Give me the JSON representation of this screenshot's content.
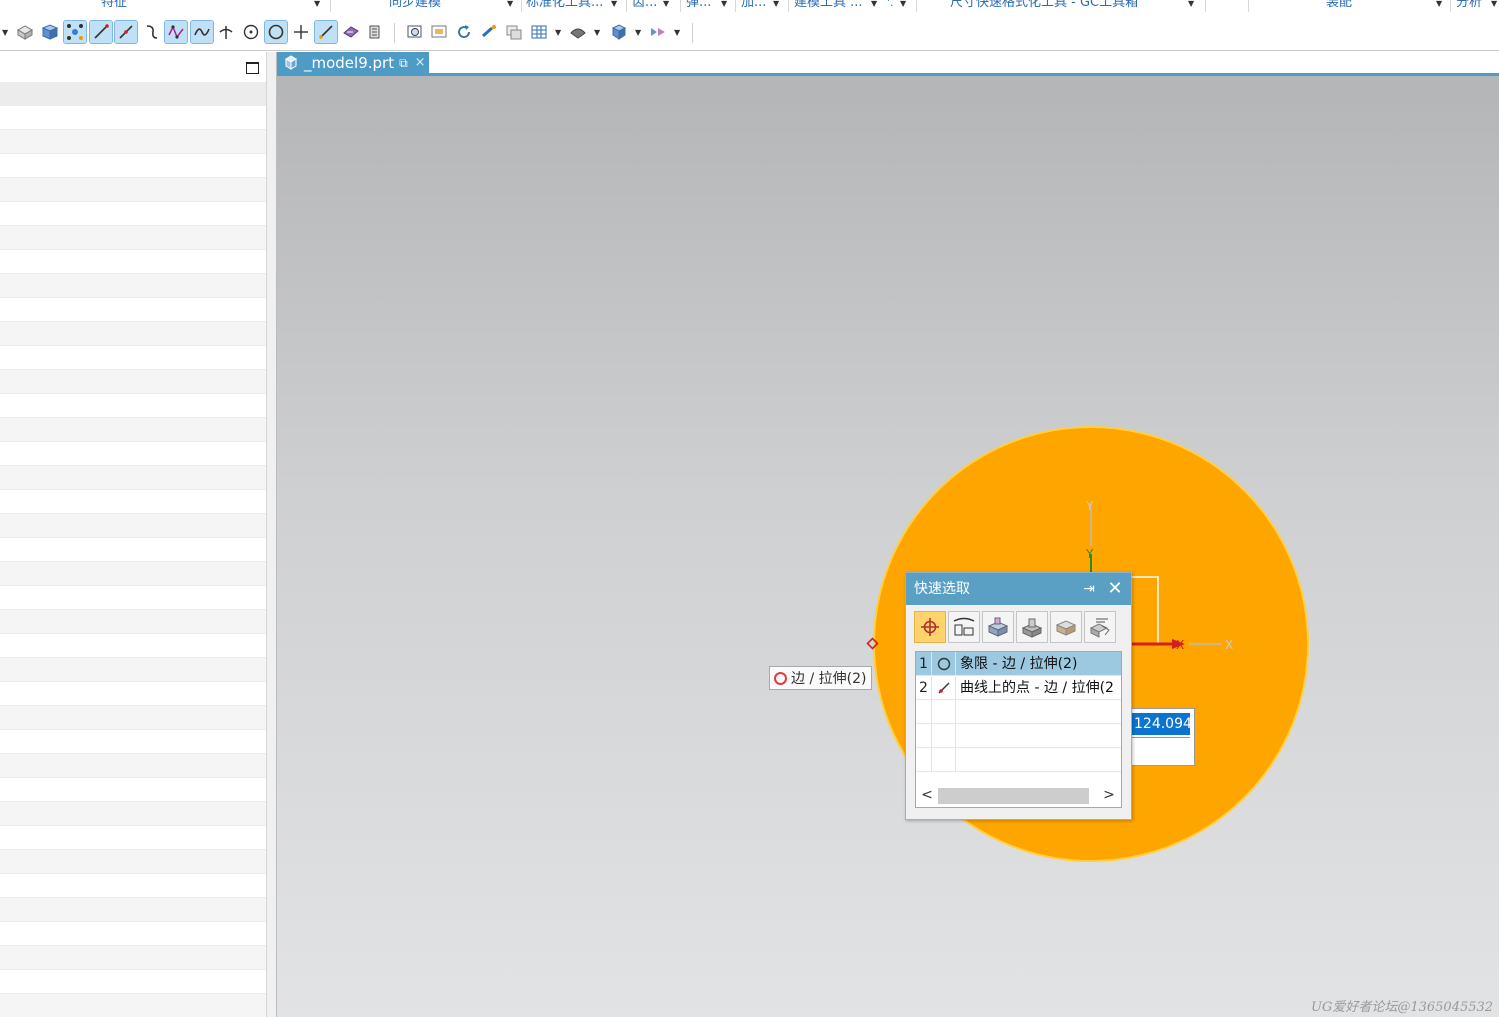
{
  "ribbon_groups": [
    {
      "label": "特征"
    },
    {
      "label": "同步建模"
    },
    {
      "label": "标准化工具..."
    },
    {
      "label": "齿..."
    },
    {
      "label": "弹..."
    },
    {
      "label": "加..."
    },
    {
      "label": "建模工具 ..."
    },
    {
      "label": "尺寸快速格式化工具 - GC工具箱"
    },
    {
      "label": "装配"
    },
    {
      "label": "分析"
    }
  ],
  "toolbar_icons": [
    "box-icon",
    "solid-block-icon",
    "point-snap-icon",
    "line-icon",
    "line-icon",
    "arc-icon",
    "studio-spline-icon",
    "curve-icon",
    "intersection-icon",
    "circle-center-icon",
    "circle-icon",
    "crosshair-icon",
    "line-on-curve-icon",
    "chamfer-icon",
    "stack-icon",
    "zoom-fit-icon",
    "view-icon",
    "rotate-icon",
    "pan-icon",
    "layer-icon",
    "grid-icon",
    "shade-icon",
    "cube-icon",
    "render-icon"
  ],
  "file_tab": {
    "name": "_model9.prt",
    "close": "×"
  },
  "hover_tip": {
    "text": "边 / 拉伸(2)"
  },
  "value_input": {
    "value": "124.094",
    "visible_text": "124.094"
  },
  "quick_pick": {
    "title": "快速选取",
    "pin": "⇥",
    "close": "✕",
    "filters": [
      "point-filter-icon",
      "curve-filter-icon",
      "face-filter-icon",
      "body-filter-icon",
      "feature-filter-icon",
      "component-filter-icon"
    ],
    "rows": [
      {
        "num": "1",
        "icon": "circle-icon",
        "text": "象限 - 边 / 拉伸(2)"
      },
      {
        "num": "2",
        "icon": "point-on-curve-icon",
        "text": "曲线上的点 - 边 / 拉伸(2"
      }
    ],
    "scroll_left": "<",
    "scroll_right": ">"
  },
  "triad": {
    "x_label": "X",
    "y_label": "Y"
  },
  "watermark": "UG爱好者论坛@1365045532",
  "colors": {
    "model_fill": "#ffa500",
    "selection_blue": "#0a74d0",
    "dialog_title": "#5a9fc4",
    "tab_blue": "#4e9bc6"
  }
}
